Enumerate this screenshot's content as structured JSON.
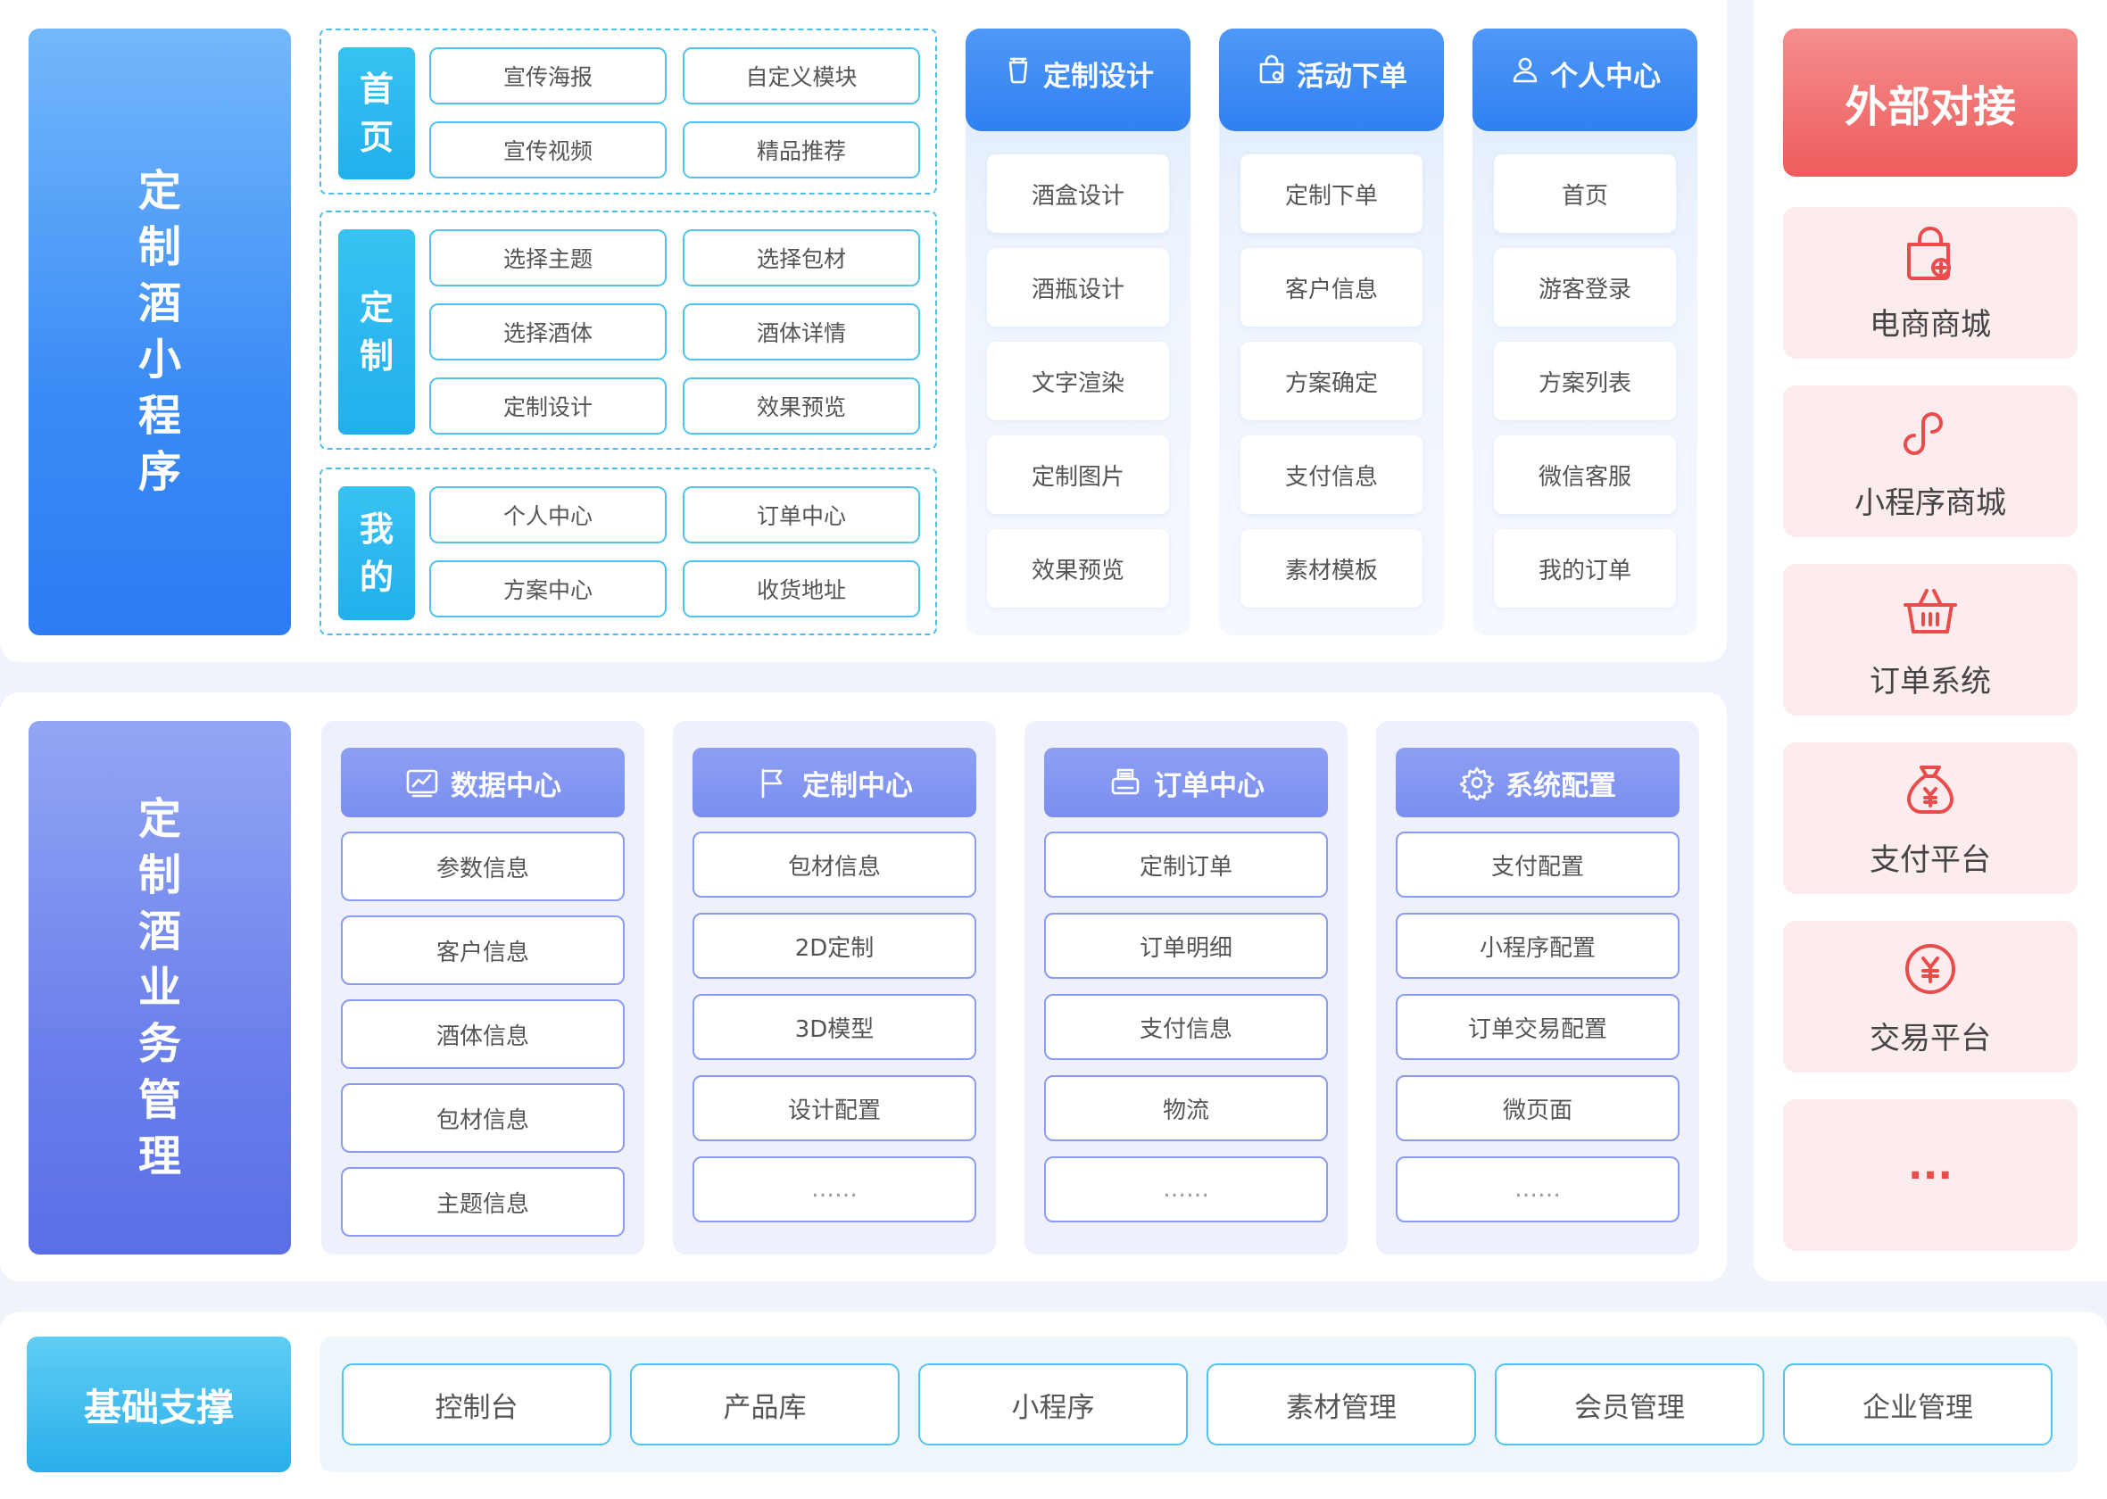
{
  "section1": {
    "title": "定制酒小程序",
    "groups": [
      {
        "tag": "首页",
        "items": [
          "宣传海报",
          "自定义模块",
          "宣传视频",
          "精品推荐"
        ]
      },
      {
        "tag": "定制",
        "items": [
          "选择主题",
          "选择包材",
          "选择酒体",
          "酒体详情",
          "定制设计",
          "效果预览"
        ]
      },
      {
        "tag": "我的",
        "items": [
          "个人中心",
          "订单中心",
          "方案中心",
          "收货地址"
        ]
      }
    ],
    "columns": [
      {
        "title": "定制设计",
        "icon": "cup-icon",
        "items": [
          "酒盒设计",
          "酒瓶设计",
          "文字渲染",
          "定制图片",
          "效果预览"
        ]
      },
      {
        "title": "活动下单",
        "icon": "shopping-bag-icon",
        "items": [
          "定制下单",
          "客户信息",
          "方案确定",
          "支付信息",
          "素材模板"
        ]
      },
      {
        "title": "个人中心",
        "icon": "user-icon",
        "items": [
          "首页",
          "游客登录",
          "方案列表",
          "微信客服",
          "我的订单"
        ]
      }
    ]
  },
  "section2": {
    "title": "定制酒业务管理",
    "columns": [
      {
        "title": "数据中心",
        "icon": "chart-icon",
        "items": [
          "参数信息",
          "客户信息",
          "酒体信息",
          "包材信息",
          "主题信息"
        ]
      },
      {
        "title": "定制中心",
        "icon": "flag-icon",
        "items": [
          "包材信息",
          "2D定制",
          "3D模型",
          "设计配置",
          "……"
        ]
      },
      {
        "title": "订单中心",
        "icon": "printer-icon",
        "items": [
          "定制订单",
          "订单明细",
          "支付信息",
          "物流",
          "……"
        ]
      },
      {
        "title": "系统配置",
        "icon": "gear-icon",
        "items": [
          "支付配置",
          "小程序配置",
          "订单交易配置",
          "微页面",
          "……"
        ]
      }
    ]
  },
  "external": {
    "title": "外部对接",
    "items": [
      {
        "label": "电商商城",
        "icon": "shopping-bag-plus-icon"
      },
      {
        "label": "小程序商城",
        "icon": "link-icon"
      },
      {
        "label": "订单系统",
        "icon": "basket-icon"
      },
      {
        "label": "支付平台",
        "icon": "money-bag-icon"
      },
      {
        "label": "交易平台",
        "icon": "yen-circle-icon"
      },
      {
        "label": "···",
        "icon": ""
      }
    ]
  },
  "base": {
    "title": "基础支撑",
    "items": [
      "控制台",
      "产品库",
      "小程序",
      "素材管理",
      "会员管理",
      "企业管理"
    ]
  },
  "colors": {
    "blue": "#2d7cf2",
    "cyan": "#22b0ec",
    "purple": "#7b8ef0",
    "red": "#ee5c5c",
    "pink_bg": "#fcecee"
  }
}
